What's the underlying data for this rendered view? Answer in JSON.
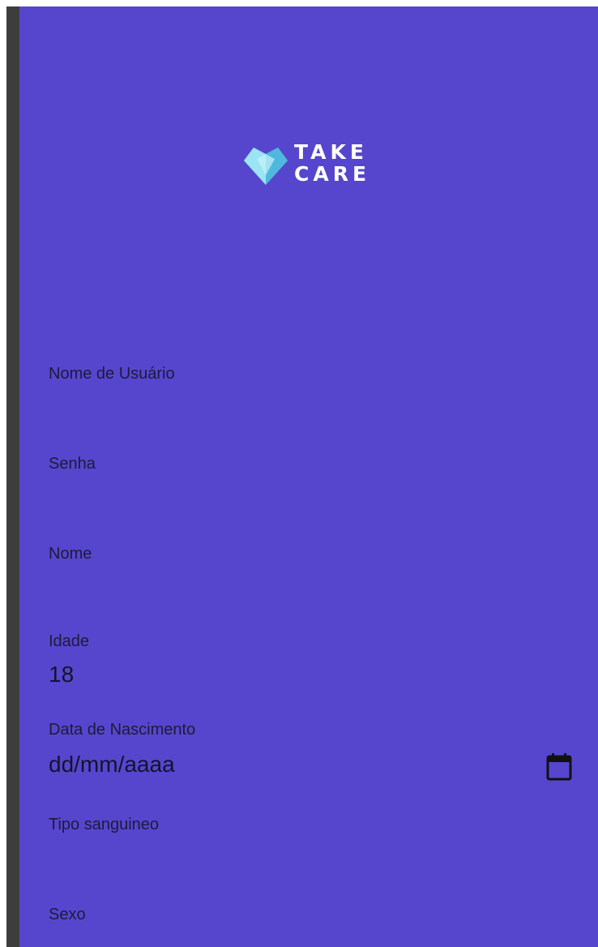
{
  "app": {
    "logo_text_line1": "TAKE",
    "logo_text_line2": "CARE"
  },
  "colors": {
    "panel_background": "#5646cd",
    "left_border": "#3d3d3d",
    "logo_gem_light": "#8fe0f0",
    "logo_gem_dark": "#4fb8dc",
    "label_text": "#1e1a3a"
  },
  "form": {
    "username": {
      "label": "Nome de Usuário"
    },
    "password": {
      "label": "Senha"
    },
    "name": {
      "label": "Nome"
    },
    "age": {
      "label": "Idade",
      "value": "18"
    },
    "birthdate": {
      "label": "Data de Nascimento",
      "placeholder": "dd/mm/aaaa",
      "icon": "calendar-icon"
    },
    "blood_type": {
      "label": "Tipo sanguineo"
    },
    "sex": {
      "label": "Sexo"
    }
  }
}
